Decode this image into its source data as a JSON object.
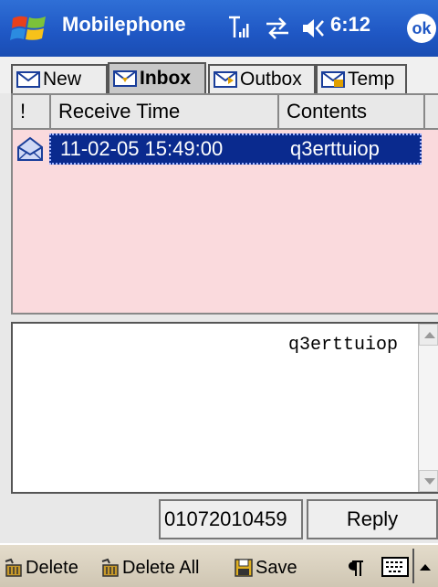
{
  "titlebar": {
    "app_title": "Mobilephone",
    "time": "6:12",
    "ok_label": "ok",
    "icons": [
      "windows-start-icon",
      "signal-icon",
      "sync-icon",
      "speaker-icon"
    ]
  },
  "tabs": [
    {
      "label": "New",
      "active": false
    },
    {
      "label": "Inbox",
      "active": true
    },
    {
      "label": "Outbox",
      "active": false
    },
    {
      "label": "Temp",
      "active": false
    }
  ],
  "list": {
    "columns": [
      "!",
      "Receive Time",
      "Contents"
    ],
    "rows": [
      {
        "time": "11-02-05 15:49:00",
        "contents": "q3erttuiop",
        "selected": true,
        "icon": "open-envelope-icon"
      }
    ]
  },
  "message_body": "q3erttuiop",
  "controls": {
    "phone_number": "01072010459",
    "reply_label": "Reply"
  },
  "menu": {
    "delete_label": "Delete",
    "delete_all_label": "Delete All",
    "save_label": "Save"
  },
  "colors": {
    "titlebar": "#1f57c4",
    "list_background": "#fadadd",
    "selection": "#0a2a8e"
  }
}
